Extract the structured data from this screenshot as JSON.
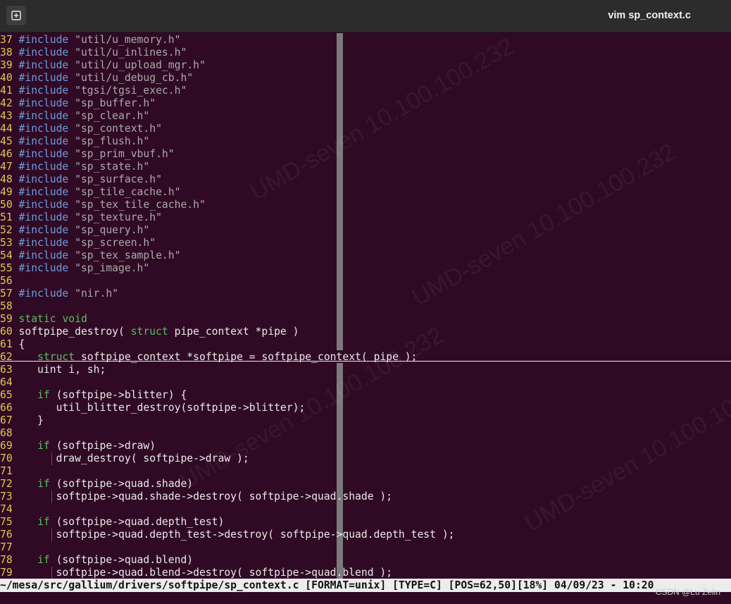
{
  "window": {
    "title": "vim sp_context.c",
    "new_tab_icon": "new-tab-icon"
  },
  "editor": {
    "lines": [
      {
        "n": "37",
        "parts": [
          {
            "c": "pp",
            "t": "#include"
          },
          {
            "c": "",
            "t": " "
          },
          {
            "c": "str",
            "t": "\"util/u_memory.h\""
          }
        ]
      },
      {
        "n": "38",
        "parts": [
          {
            "c": "pp",
            "t": "#include"
          },
          {
            "c": "",
            "t": " "
          },
          {
            "c": "str",
            "t": "\"util/u_inlines.h\""
          }
        ]
      },
      {
        "n": "39",
        "parts": [
          {
            "c": "pp",
            "t": "#include"
          },
          {
            "c": "",
            "t": " "
          },
          {
            "c": "str",
            "t": "\"util/u_upload_mgr.h\""
          }
        ]
      },
      {
        "n": "40",
        "parts": [
          {
            "c": "pp",
            "t": "#include"
          },
          {
            "c": "",
            "t": " "
          },
          {
            "c": "str",
            "t": "\"util/u_debug_cb.h\""
          }
        ]
      },
      {
        "n": "41",
        "parts": [
          {
            "c": "pp",
            "t": "#include"
          },
          {
            "c": "",
            "t": " "
          },
          {
            "c": "str",
            "t": "\"tgsi/tgsi_exec.h\""
          }
        ]
      },
      {
        "n": "42",
        "parts": [
          {
            "c": "pp",
            "t": "#include"
          },
          {
            "c": "",
            "t": " "
          },
          {
            "c": "str",
            "t": "\"sp_buffer.h\""
          }
        ]
      },
      {
        "n": "43",
        "parts": [
          {
            "c": "pp",
            "t": "#include"
          },
          {
            "c": "",
            "t": " "
          },
          {
            "c": "str",
            "t": "\"sp_clear.h\""
          }
        ]
      },
      {
        "n": "44",
        "parts": [
          {
            "c": "pp",
            "t": "#include"
          },
          {
            "c": "",
            "t": " "
          },
          {
            "c": "str",
            "t": "\"sp_context.h\""
          }
        ]
      },
      {
        "n": "45",
        "parts": [
          {
            "c": "pp",
            "t": "#include"
          },
          {
            "c": "",
            "t": " "
          },
          {
            "c": "str",
            "t": "\"sp_flush.h\""
          }
        ]
      },
      {
        "n": "46",
        "parts": [
          {
            "c": "pp",
            "t": "#include"
          },
          {
            "c": "",
            "t": " "
          },
          {
            "c": "str",
            "t": "\"sp_prim_vbuf.h\""
          }
        ]
      },
      {
        "n": "47",
        "parts": [
          {
            "c": "pp",
            "t": "#include"
          },
          {
            "c": "",
            "t": " "
          },
          {
            "c": "str",
            "t": "\"sp_state.h\""
          }
        ]
      },
      {
        "n": "48",
        "parts": [
          {
            "c": "pp",
            "t": "#include"
          },
          {
            "c": "",
            "t": " "
          },
          {
            "c": "str",
            "t": "\"sp_surface.h\""
          }
        ]
      },
      {
        "n": "49",
        "parts": [
          {
            "c": "pp",
            "t": "#include"
          },
          {
            "c": "",
            "t": " "
          },
          {
            "c": "str",
            "t": "\"sp_tile_cache.h\""
          }
        ]
      },
      {
        "n": "50",
        "parts": [
          {
            "c": "pp",
            "t": "#include"
          },
          {
            "c": "",
            "t": " "
          },
          {
            "c": "str",
            "t": "\"sp_tex_tile_cache.h\""
          }
        ]
      },
      {
        "n": "51",
        "parts": [
          {
            "c": "pp",
            "t": "#include"
          },
          {
            "c": "",
            "t": " "
          },
          {
            "c": "str",
            "t": "\"sp_texture.h\""
          }
        ]
      },
      {
        "n": "52",
        "parts": [
          {
            "c": "pp",
            "t": "#include"
          },
          {
            "c": "",
            "t": " "
          },
          {
            "c": "str",
            "t": "\"sp_query.h\""
          }
        ]
      },
      {
        "n": "53",
        "parts": [
          {
            "c": "pp",
            "t": "#include"
          },
          {
            "c": "",
            "t": " "
          },
          {
            "c": "str",
            "t": "\"sp_screen.h\""
          }
        ]
      },
      {
        "n": "54",
        "parts": [
          {
            "c": "pp",
            "t": "#include"
          },
          {
            "c": "",
            "t": " "
          },
          {
            "c": "str",
            "t": "\"sp_tex_sample.h\""
          }
        ]
      },
      {
        "n": "55",
        "parts": [
          {
            "c": "pp",
            "t": "#include"
          },
          {
            "c": "",
            "t": " "
          },
          {
            "c": "str",
            "t": "\"sp_image.h\""
          }
        ]
      },
      {
        "n": "56",
        "parts": []
      },
      {
        "n": "57",
        "parts": [
          {
            "c": "pp",
            "t": "#include"
          },
          {
            "c": "",
            "t": " "
          },
          {
            "c": "str",
            "t": "\"nir.h\""
          }
        ]
      },
      {
        "n": "58",
        "parts": []
      },
      {
        "n": "59",
        "parts": [
          {
            "c": "ty",
            "t": "static"
          },
          {
            "c": "",
            "t": " "
          },
          {
            "c": "ty",
            "t": "void"
          }
        ]
      },
      {
        "n": "60",
        "parts": [
          {
            "c": "",
            "t": "softpipe_destroy( "
          },
          {
            "c": "ty",
            "t": "struct"
          },
          {
            "c": "",
            "t": " pipe_context *pipe )"
          }
        ]
      },
      {
        "n": "61",
        "parts": [
          {
            "c": "",
            "t": "{"
          }
        ]
      },
      {
        "n": "62",
        "cursor": true,
        "parts": [
          {
            "c": "",
            "t": "   "
          },
          {
            "c": "ty",
            "t": "struct"
          },
          {
            "c": "",
            "t": " softpipe_context *softpipe = softpipe_context( pipe );"
          }
        ]
      },
      {
        "n": "63",
        "parts": [
          {
            "c": "",
            "t": "   uint i, sh;"
          }
        ]
      },
      {
        "n": "64",
        "parts": []
      },
      {
        "n": "65",
        "parts": [
          {
            "c": "",
            "t": "   "
          },
          {
            "c": "ty",
            "t": "if"
          },
          {
            "c": "",
            "t": " (softpipe->blitter) {"
          }
        ]
      },
      {
        "n": "66",
        "parts": [
          {
            "c": "",
            "t": "      util_blitter_destroy(softpipe->blitter);"
          }
        ]
      },
      {
        "n": "67",
        "parts": [
          {
            "c": "",
            "t": "   }"
          }
        ]
      },
      {
        "n": "68",
        "parts": []
      },
      {
        "n": "69",
        "parts": [
          {
            "c": "",
            "t": "   "
          },
          {
            "c": "ty",
            "t": "if"
          },
          {
            "c": "",
            "t": " (softpipe->draw)"
          }
        ]
      },
      {
        "n": "70",
        "parts": [
          {
            "c": "",
            "t": "      draw_destroy( softpipe->draw );"
          }
        ]
      },
      {
        "n": "71",
        "parts": []
      },
      {
        "n": "72",
        "parts": [
          {
            "c": "",
            "t": "   "
          },
          {
            "c": "ty",
            "t": "if"
          },
          {
            "c": "",
            "t": " (softpipe->quad.shade)"
          }
        ]
      },
      {
        "n": "73",
        "parts": [
          {
            "c": "",
            "t": "      softpipe->quad.shade->destroy( softpipe->quad.shade );"
          }
        ]
      },
      {
        "n": "74",
        "parts": []
      },
      {
        "n": "75",
        "parts": [
          {
            "c": "",
            "t": "   "
          },
          {
            "c": "ty",
            "t": "if"
          },
          {
            "c": "",
            "t": " (softpipe->quad.depth_test)"
          }
        ]
      },
      {
        "n": "76",
        "parts": [
          {
            "c": "",
            "t": "      softpipe->quad.depth_test->destroy( softpipe->quad.depth_test );"
          }
        ]
      },
      {
        "n": "77",
        "parts": []
      },
      {
        "n": "78",
        "parts": [
          {
            "c": "",
            "t": "   "
          },
          {
            "c": "ty",
            "t": "if"
          },
          {
            "c": "",
            "t": " (softpipe->quad.blend)"
          }
        ]
      },
      {
        "n": "79",
        "parts": [
          {
            "c": "",
            "t": "      softpipe->quad.blend->destroy( softpipe->quad.blend );"
          }
        ]
      }
    ]
  },
  "statusline": {
    "text": "~/mesa/src/gallium/drivers/softpipe/sp_context.c [FORMAT=unix] [TYPE=C] [POS=62,50][18%] 04/09/23 - 10:20"
  },
  "credit": "CSDN @Lu Zelin",
  "watermarks": [
    "UMD-seven 10.100.100.232",
    "UMD-seven 10.100.100.232",
    "UMD-seven 10.100.100.232",
    "UMD-seven 10.100.100.232"
  ],
  "colors": {
    "background": "#300a24",
    "line_number": "#e2c84c",
    "preproc": "#6c9ddc",
    "string": "#aaaaaa",
    "keyword": "#57bf5a",
    "text": "#eaeaea"
  }
}
